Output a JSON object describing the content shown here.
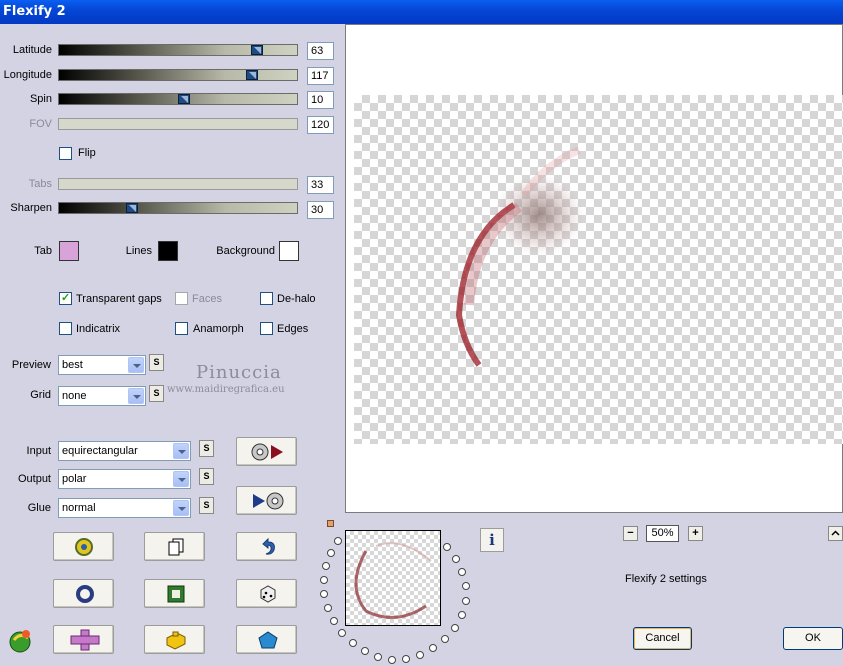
{
  "window": {
    "title": "Flexify 2"
  },
  "sliders": [
    {
      "label": "Latitude",
      "value": "63",
      "position": 0.84,
      "enabled": true
    },
    {
      "label": "Longitude",
      "value": "117",
      "position": 0.81,
      "enabled": true
    },
    {
      "label": "Spin",
      "value": "10",
      "position": 0.5,
      "enabled": true
    },
    {
      "label": "FOV",
      "value": "120",
      "position": null,
      "enabled": false
    },
    {
      "label": "Tabs",
      "value": "33",
      "position": null,
      "enabled": false
    },
    {
      "label": "Sharpen",
      "value": "30",
      "position": 0.3,
      "enabled": true
    }
  ],
  "flip": {
    "label": "Flip",
    "checked": false
  },
  "colors": {
    "tab_label": "Tab",
    "tab_color": "#d7a3d8",
    "lines_label": "Lines",
    "lines_color": "#000000",
    "background_label": "Background",
    "background_color": "#ffffff"
  },
  "options": {
    "transparent_gaps": {
      "label": "Transparent gaps",
      "checked": true
    },
    "faces": {
      "label": "Faces",
      "checked": false,
      "enabled": false
    },
    "de_halo": {
      "label": "De-halo",
      "checked": false
    },
    "indicatrix": {
      "label": "Indicatrix",
      "checked": false
    },
    "anamorph": {
      "label": "Anamorph",
      "checked": false
    },
    "edges": {
      "label": "Edges",
      "checked": false
    }
  },
  "preview": {
    "label": "Preview",
    "value": "best"
  },
  "grid": {
    "label": "Grid",
    "value": "none"
  },
  "input": {
    "label": "Input",
    "value": "equirectangular"
  },
  "output": {
    "label": "Output",
    "value": "polar"
  },
  "glue": {
    "label": "Glue",
    "value": "normal"
  },
  "s_button_label": "S",
  "watermark": {
    "name": "Pinuccia",
    "url": "www.maidiregrafica.eu"
  },
  "zoom": {
    "value": "50%",
    "minus": "−",
    "plus": "+"
  },
  "settings_label": "Flexify 2 settings",
  "info_icon_label": "i",
  "buttons": {
    "cancel": "Cancel",
    "ok": "OK"
  },
  "tool_icons": [
    "randomize-icon",
    "copy-icon",
    "undo-icon",
    "ring-icon",
    "frame-icon",
    "dice-icon",
    "cross-icon",
    "puzzle-icon",
    "pentagon-icon"
  ]
}
